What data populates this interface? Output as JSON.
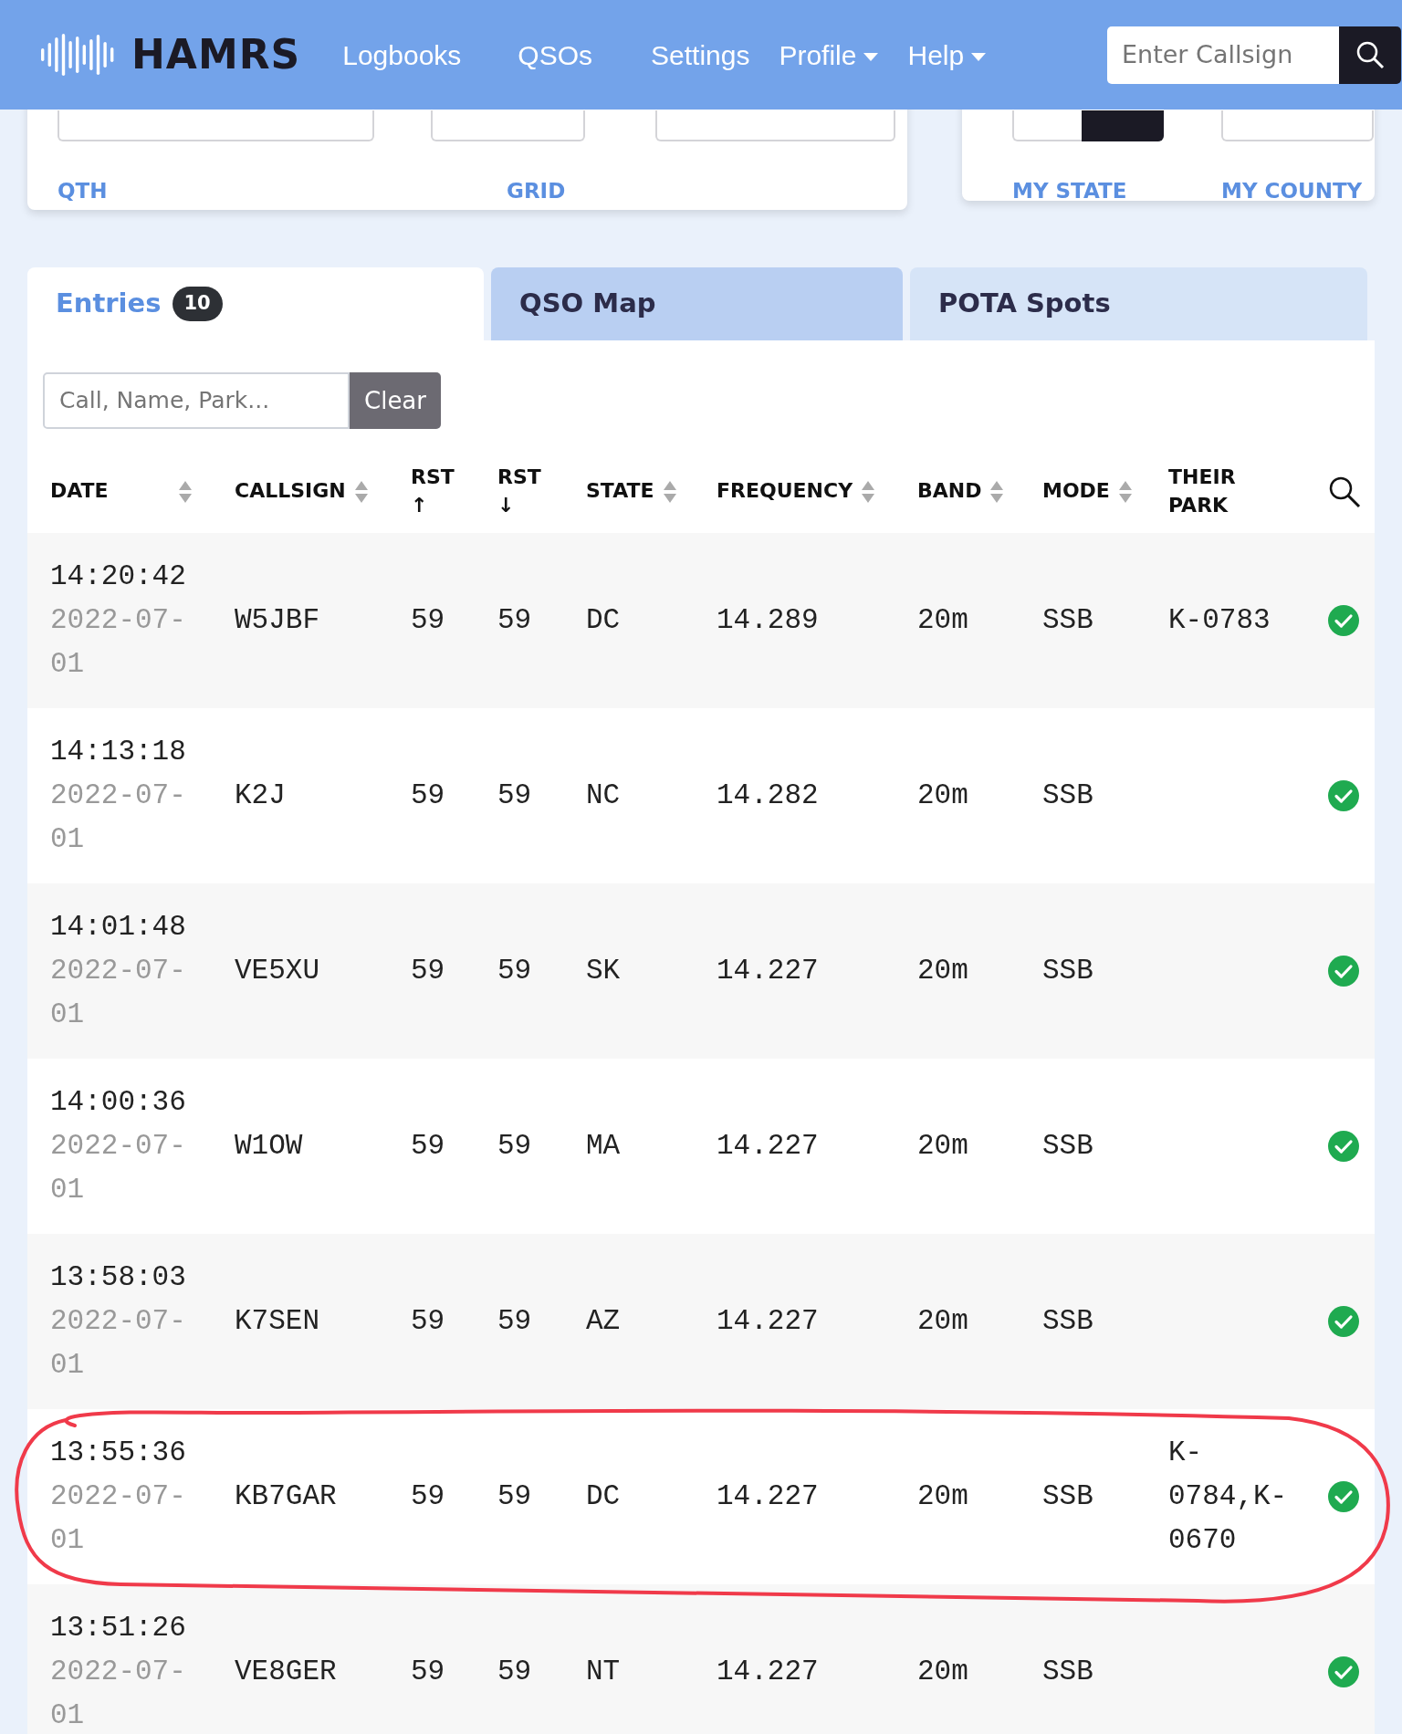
{
  "navbar": {
    "brand": "HAMRS",
    "links": [
      {
        "label": "Logbooks",
        "dropdown": false
      },
      {
        "label": "QSOs",
        "dropdown": false
      },
      {
        "label": "Settings",
        "dropdown": false
      },
      {
        "label": "Profile",
        "dropdown": true
      },
      {
        "label": "Help",
        "dropdown": true
      }
    ],
    "search": {
      "placeholder": "Enter Callsign"
    }
  },
  "station_card": {
    "labels": [
      "QTH",
      "GRID"
    ]
  },
  "operator_card": {
    "labels": [
      "MY STATE",
      "MY COUNTY"
    ]
  },
  "tabs": [
    {
      "label": "Entries",
      "badge": "10",
      "selected": true
    },
    {
      "label": "QSO Map",
      "selected": false
    },
    {
      "label": "POTA Spots",
      "selected": false
    }
  ],
  "filter": {
    "placeholder": "Call, Name, Park...",
    "button": "Clear"
  },
  "columns": [
    {
      "label": "DATE",
      "sortable": true
    },
    {
      "label": "CALLSIGN",
      "sortable": true
    },
    {
      "label": "RST ↑",
      "sortable": false
    },
    {
      "label": "RST ↓",
      "sortable": false
    },
    {
      "label": "STATE",
      "sortable": true
    },
    {
      "label": "FREQUENCY",
      "sortable": true
    },
    {
      "label": "BAND",
      "sortable": true
    },
    {
      "label": "MODE",
      "sortable": true
    },
    {
      "label": "THEIR PARK",
      "sortable": false
    }
  ],
  "rows": [
    {
      "time": "14:20:42",
      "date": "2022-07-01",
      "callsign": "W5JBF",
      "rst_sent": "59",
      "rst_rcvd": "59",
      "state": "DC",
      "frequency": "14.289",
      "band": "20m",
      "mode": "SSB",
      "park": "K-0783",
      "confirmed": true,
      "circled": false
    },
    {
      "time": "14:13:18",
      "date": "2022-07-01",
      "callsign": "K2J",
      "rst_sent": "59",
      "rst_rcvd": "59",
      "state": "NC",
      "frequency": "14.282",
      "band": "20m",
      "mode": "SSB",
      "confirmed": true,
      "circled": false
    },
    {
      "time": "14:01:48",
      "date": "2022-07-01",
      "callsign": "VE5XU",
      "rst_sent": "59",
      "rst_rcvd": "59",
      "state": "SK",
      "frequency": "14.227",
      "band": "20m",
      "mode": "SSB",
      "confirmed": true,
      "circled": false
    },
    {
      "time": "14:00:36",
      "date": "2022-07-01",
      "callsign": "W1OW",
      "rst_sent": "59",
      "rst_rcvd": "59",
      "state": "MA",
      "frequency": "14.227",
      "band": "20m",
      "mode": "SSB",
      "confirmed": true,
      "circled": false
    },
    {
      "time": "13:58:03",
      "date": "2022-07-01",
      "callsign": "K7SEN",
      "rst_sent": "59",
      "rst_rcvd": "59",
      "state": "AZ",
      "frequency": "14.227",
      "band": "20m",
      "mode": "SSB",
      "confirmed": true,
      "circled": false
    },
    {
      "time": "13:55:36",
      "date": "2022-07-01",
      "callsign": "KB7GAR",
      "rst_sent": "59",
      "rst_rcvd": "59",
      "state": "DC",
      "frequency": "14.227",
      "band": "20m",
      "mode": "SSB",
      "park": "K-0784,K-0670",
      "confirmed": true,
      "circled": true
    },
    {
      "time": "13:51:26",
      "date": "2022-07-01",
      "callsign": "VE8GER",
      "rst_sent": "59",
      "rst_rcvd": "59",
      "state": "NT",
      "frequency": "14.227",
      "band": "20m",
      "mode": "SSB",
      "confirmed": true,
      "circled": false
    }
  ]
}
